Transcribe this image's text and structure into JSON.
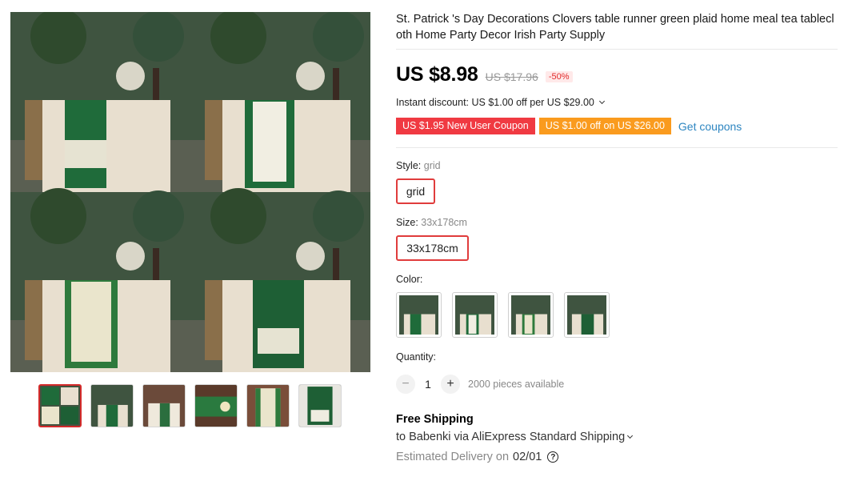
{
  "product": {
    "title": "St. Patrick 's Day Decorations Clovers table runner green plaid home meal tea tablecloth Home Party Decor Irish Party Supply"
  },
  "price": {
    "current": "US $8.98",
    "original": "US $17.96",
    "discount_badge": "-50%"
  },
  "instant_discount": "Instant discount: US $1.00 off per US $29.00",
  "coupons": {
    "new_user": "US $1.95 New User Coupon",
    "store": "US $1.00 off on US $26.00",
    "get_link": "Get coupons"
  },
  "style": {
    "label": "Style: ",
    "value": "grid",
    "option": "grid"
  },
  "size": {
    "label": "Size: ",
    "value": "33x178cm",
    "option": "33x178cm"
  },
  "color": {
    "label": "Color:",
    "swatch_count": 4
  },
  "quantity": {
    "label": "Quantity:",
    "minus": "−",
    "value": "1",
    "plus": "+",
    "available": "2000 pieces available"
  },
  "shipping": {
    "title": "Free Shipping",
    "line": "to Babenki via AliExpress Standard Shipping",
    "delivery_prefix": "Estimated Delivery on",
    "delivery_date": "02/01",
    "help_glyph": "?"
  },
  "gallery": {
    "thumbnail_count": 6,
    "active_thumbnail": 1
  },
  "colors": {
    "accent_red": "#e03c3c",
    "coupon_red": "#f03a42",
    "coupon_orange": "#fa9b1e",
    "link_blue": "#2e86c1",
    "runner_green": "#1f6b3a"
  }
}
